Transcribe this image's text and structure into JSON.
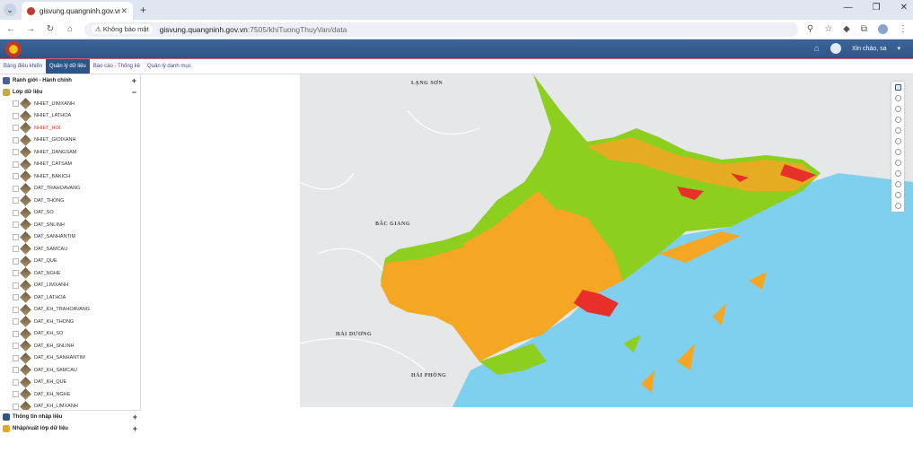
{
  "browser": {
    "tab_title": "gisvung.quangninh.gov.vn:7505",
    "tab_close": "✕",
    "new_tab": "+",
    "security_label": "Không bảo mật",
    "url_host": "gisvung.quangninh.gov.vn",
    "url_path": ":7505/khiTuongThuyVan/data",
    "window_controls": [
      "—",
      "❐",
      "✕"
    ]
  },
  "header": {
    "user_greeting": "Xin chào, sa"
  },
  "menu": [
    {
      "label": "Bảng điều khiển",
      "active": false
    },
    {
      "label": "Quản lý dữ liệu",
      "active": true
    },
    {
      "label": "Báo cáo - Thống kê",
      "active": false
    },
    {
      "label": "Quản lý danh mục",
      "active": false
    }
  ],
  "sidebar": {
    "section_boundary": "Ranh giới - Hành chính",
    "section_layers": "Lớp dữ liệu",
    "layers": [
      {
        "name": "NHIET_UIMXANH",
        "highlighted": false
      },
      {
        "name": "NHIET_LATHOA",
        "highlighted": false
      },
      {
        "name": "NHIET_HOI",
        "highlighted": true
      },
      {
        "name": "NHIET_GIOIXANH",
        "highlighted": false
      },
      {
        "name": "NHIET_DANGSAM",
        "highlighted": false
      },
      {
        "name": "NHIET_CATSAM",
        "highlighted": false
      },
      {
        "name": "NHIET_BAKICH",
        "highlighted": false
      },
      {
        "name": "DAT_TRAHOAVANG",
        "highlighted": false
      },
      {
        "name": "DAT_THONG",
        "highlighted": false
      },
      {
        "name": "DAT_SO",
        "highlighted": false
      },
      {
        "name": "DAT_SNLINH",
        "highlighted": false
      },
      {
        "name": "DAT_SANHANTIM",
        "highlighted": false
      },
      {
        "name": "DAT_SAMCAU",
        "highlighted": false
      },
      {
        "name": "DAT_QUE",
        "highlighted": false
      },
      {
        "name": "DAT_NGHE",
        "highlighted": false
      },
      {
        "name": "DAT_LIMXANH",
        "highlighted": false
      },
      {
        "name": "DAT_LATHOA",
        "highlighted": false
      },
      {
        "name": "DAT_KH_TRAHOAVANG",
        "highlighted": false
      },
      {
        "name": "DAT_KH_THONG",
        "highlighted": false
      },
      {
        "name": "DAT_KH_SO",
        "highlighted": false
      },
      {
        "name": "DAT_KH_SNLINH",
        "highlighted": false
      },
      {
        "name": "DAT_KH_SANHANTIM",
        "highlighted": false
      },
      {
        "name": "DAT_KH_SAMCAU",
        "highlighted": false
      },
      {
        "name": "DAT_KH_QUE",
        "highlighted": false
      },
      {
        "name": "DAT_KH_NGHE",
        "highlighted": false
      },
      {
        "name": "DAT_KH_LIMXANH",
        "highlighted": false
      }
    ],
    "section_import_info": "Thông tin nhập liệu",
    "section_import_export": "Nhập/xuất lớp dữ liệu"
  },
  "map": {
    "labels": [
      "LẠNG SƠN",
      "BẮC GIANG",
      "HẢI DƯƠNG",
      "HẢI PHÒNG"
    ],
    "colors": {
      "low": "#8ccf1e",
      "mid": "#f5a623",
      "high": "#e8302a",
      "sea": "#7fd0ee",
      "land": "#e6e7e9"
    },
    "tools": [
      "layers-icon",
      "zoom-in-icon",
      "zoom-out-icon",
      "info-icon",
      "locate-icon",
      "history-icon",
      "measure-icon",
      "extent-icon",
      "globe-icon",
      "print-icon",
      "world-icon",
      "refresh-icon"
    ]
  }
}
